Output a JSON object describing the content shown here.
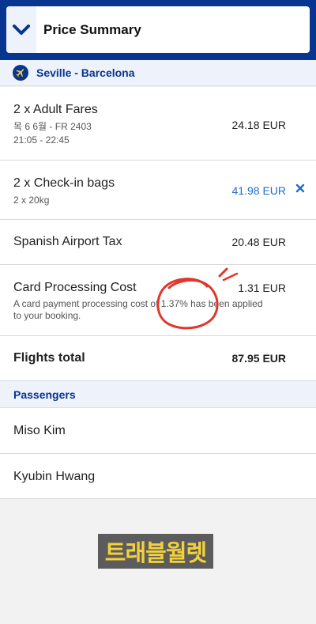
{
  "header": {
    "title": "Price Summary",
    "icon": "chevron-down-icon"
  },
  "route": {
    "label": "Seville - Barcelona",
    "icon": "plane-icon"
  },
  "fares": {
    "title": "2 x Adult Fares",
    "flight": "목 6 6월 - FR 2403",
    "time": "21:05 - 22:45",
    "amount": "24.18 EUR"
  },
  "bags": {
    "title": "2 x Check-in bags",
    "sub": "2 x 20kg",
    "amount": "41.98 EUR",
    "remove_icon": "close-icon"
  },
  "tax": {
    "title": "Spanish Airport Tax",
    "amount": "20.48 EUR"
  },
  "card": {
    "title": "Card Processing Cost",
    "amount": "1.31 EUR",
    "note_line1": "A card payment processing cost of 1.37% has been applied",
    "note_line2": "to your booking."
  },
  "total": {
    "label": "Flights total",
    "amount": "87.95 EUR"
  },
  "passengers": {
    "header": "Passengers",
    "names": [
      "Miso Kim",
      "Kyubin Hwang"
    ]
  },
  "watermark": {
    "text": "트래블월렛"
  },
  "colors": {
    "brand_navy": "#073590",
    "accent_blue": "#1e6ec8",
    "annotation_red": "#e0362b",
    "watermark_yellow": "#f3d13c"
  }
}
